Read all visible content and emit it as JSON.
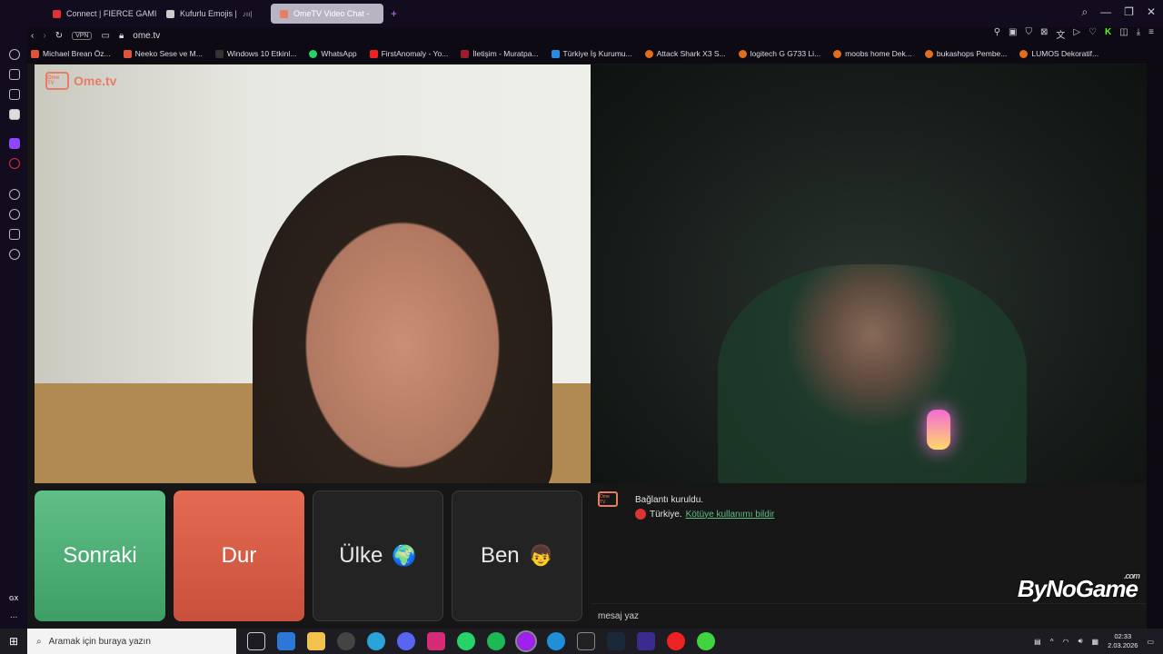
{
  "tabs": [
    {
      "label": "Connect | FIERCE GAMING",
      "color": "#d33"
    },
    {
      "label": "Kufurlu Emojis |",
      "color": "#ccc"
    },
    {
      "label": "OmeTV Video Chat -",
      "color": "#e67e66",
      "active": true
    }
  ],
  "address": {
    "vpn": "VPN",
    "url": "ome.tv"
  },
  "bookmarks": [
    {
      "label": "Michael Brean Öz...",
      "color": "#e0533b"
    },
    {
      "label": "Neeko Sese ve M...",
      "color": "#e0533b"
    },
    {
      "label": "Windows 10 Etkinl...",
      "color": "#333"
    },
    {
      "label": "WhatsApp",
      "color": "#25d366"
    },
    {
      "label": "FirstAnomaly - Yo...",
      "color": "#e22"
    },
    {
      "label": "İletişim - Muratpa...",
      "color": "#9a1e2e"
    },
    {
      "label": "Türkiye İş Kurumu...",
      "color": "#2a8adf"
    },
    {
      "label": "Attack Shark X3 S...",
      "color": "#e06e1e"
    },
    {
      "label": "logitech G G733 Li...",
      "color": "#e06e1e"
    },
    {
      "label": "moobs home Dek...",
      "color": "#e06e1e"
    },
    {
      "label": "bukashops Pembe...",
      "color": "#e06e1e"
    },
    {
      "label": "LUMOS Dekoratif...",
      "color": "#e06e1e"
    }
  ],
  "ome_logo": {
    "box": "Ome TV",
    "text": "Ome.tv"
  },
  "buttons": {
    "next": "Sonraki",
    "stop": "Dur",
    "country": "Ülke",
    "country_icon": "🌍",
    "me": "Ben",
    "me_icon": "👦"
  },
  "chat": {
    "logo": "Ome TV",
    "connected": "Bağlantı kuruldu.",
    "country": "Türkiye.",
    "report": "Kötüye kullanımı bildir",
    "input_placeholder": "mesaj yaz"
  },
  "watermark": {
    "text": "ByNoGame",
    "suffix": ".com"
  },
  "sidebar_bottom": {
    "gx": "GX",
    "more": "..."
  },
  "taskbar": {
    "search_placeholder": "Aramak için buraya yazın",
    "time": "02:33",
    "date": "2.03.2026"
  },
  "colors": {
    "accent_green": "#5fbf87",
    "accent_red": "#e56a52",
    "brand": "#e67e66"
  }
}
